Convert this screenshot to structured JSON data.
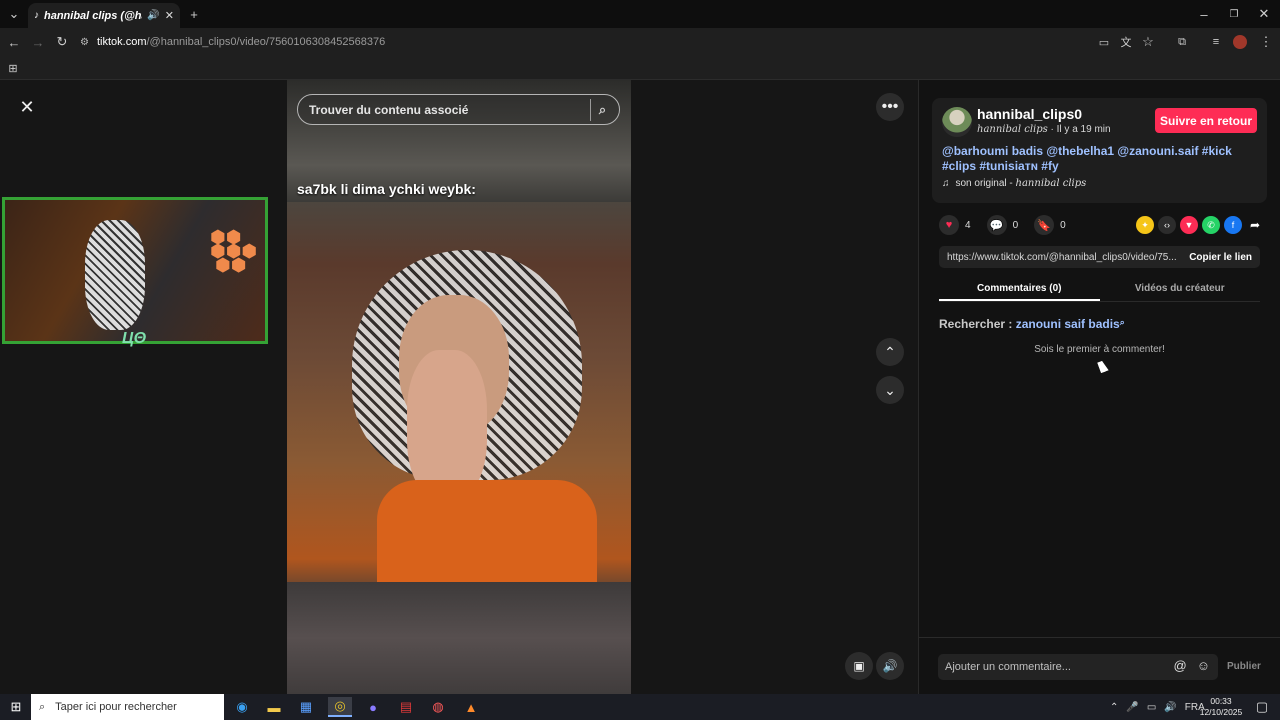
{
  "browser": {
    "tab": {
      "title": "hannibal clips (@hannibal_",
      "favicon": "tiktok-icon"
    },
    "url_host": "tiktok.com",
    "url_path": "/@hannibal_clips0/video/7560106308452568376"
  },
  "player": {
    "search_placeholder": "Trouver du contenu associé",
    "caption": "sa7bk li dima ychki weybk:"
  },
  "panel": {
    "username": "hannibal_clips0",
    "nickname": "hannibal clips",
    "time_ago": " · Il y a 19 min",
    "follow_label": "Suivre en retour",
    "description": "@barhoumi badis @thebelha1 @zanouni.saif #kick #clips #tunisiaᴛɴ #fy",
    "music_prefix": "son original - ",
    "music_author": "hannibal clips",
    "likes": "4",
    "comments": "0",
    "saves": "0",
    "link": "https://www.tiktok.com/@hannibal_clips0/video/75...",
    "copy_label": "Copier le lien",
    "tabs": [
      "Commentaires (0)",
      "Vidéos du créateur"
    ],
    "search_prefix": "Rechercher : ",
    "search_term": "zanouni saif badis",
    "empty_message": "Sois le premier à commenter!",
    "comment_placeholder": "Ajouter un commentaire...",
    "publish_label": "Publier"
  },
  "taskbar": {
    "search_placeholder": "Taper ici pour rechercher",
    "lang": "FRA",
    "time": "00:33",
    "date": "12/10/2025"
  },
  "colors": {
    "accent": "#fe2c55",
    "link": "#9fc1ff",
    "webcam_border": "#35a235"
  }
}
